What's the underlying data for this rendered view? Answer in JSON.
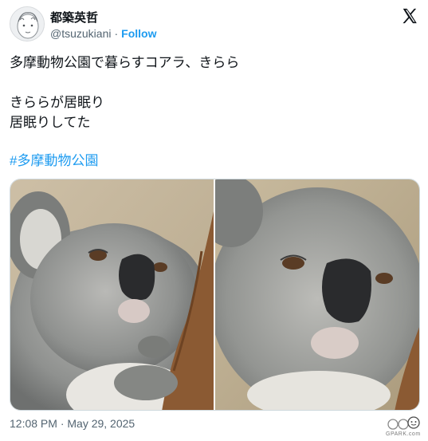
{
  "author": {
    "display_name": "都築英哲",
    "handle": "@tsuzukiani",
    "follow_label": "Follow"
  },
  "platform": {
    "logo_icon": "x-logo-icon"
  },
  "tweet": {
    "line1": "多摩動物公園で暮らすコアラ、きらら",
    "line2": "きららが居眠り",
    "line3": "居眠りしてた",
    "hashtag": "#多摩動物公園",
    "timestamp": "12:08 PM · May 29, 2025"
  },
  "media": {
    "count": 2,
    "subjects": [
      "koala-photo",
      "koala-photo"
    ]
  },
  "watermark": {
    "text": "GPARK.com"
  },
  "colors": {
    "link": "#1d9bf0",
    "text": "#0f1419",
    "muted": "#536471",
    "border": "#cfd9de"
  }
}
